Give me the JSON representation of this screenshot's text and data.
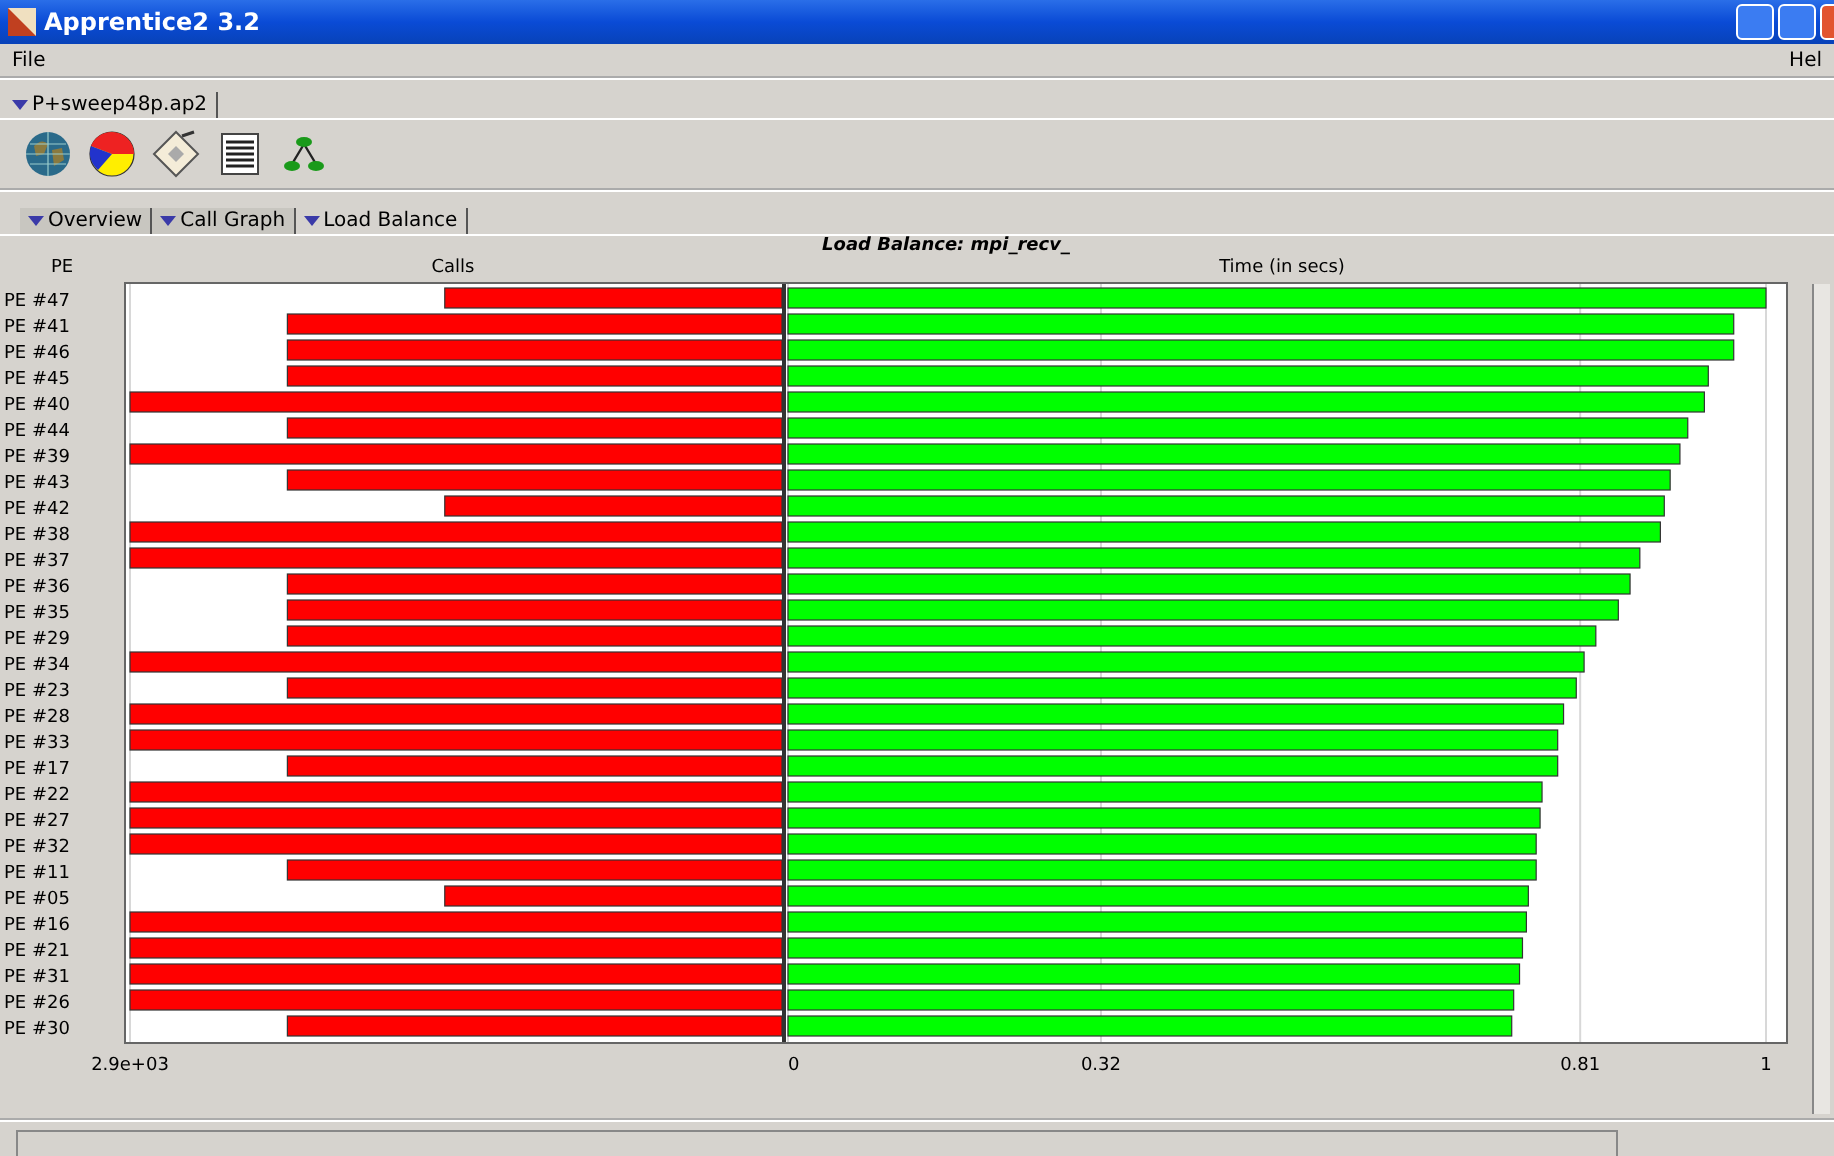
{
  "window": {
    "title": "Apprentice2 3.2"
  },
  "menu": [
    {
      "label": "File"
    },
    {
      "label": "Hel"
    }
  ],
  "file_tabs": [
    {
      "label": "P+sweep48p.ap2",
      "selected": true
    }
  ],
  "toolbar": [
    {
      "kind": "globe"
    },
    {
      "kind": "pie"
    },
    {
      "kind": "clipboard"
    },
    {
      "kind": "table"
    },
    {
      "kind": "tree"
    }
  ],
  "view_tabs": [
    {
      "label": "Overview",
      "selected": false
    },
    {
      "label": "Call Graph",
      "selected": false
    },
    {
      "label": "Load Balance",
      "selected": true
    }
  ],
  "panel": {
    "title": "Load Balance: mpi_recv_",
    "pe_header": "PE",
    "calls_chart": {
      "chart_data": {
        "type": "bar",
        "orientation": "horizontal",
        "title": "Calls",
        "xlim": [
          2900,
          0
        ],
        "xticks": [
          {
            "value": 2900,
            "label": "2.9e+03"
          }
        ],
        "categories": [
          "PE #47",
          "PE #41",
          "PE #46",
          "PE #45",
          "PE #40",
          "PE #44",
          "PE #39",
          "PE #43",
          "PE #42",
          "PE #38",
          "PE #37",
          "PE #36",
          "PE #35",
          "PE #29",
          "PE #34",
          "PE #23",
          "PE #28",
          "PE #33",
          "PE #17",
          "PE #22",
          "PE #27",
          "PE #32",
          "PE #11",
          "PE #05",
          "PE #16",
          "PE #21",
          "PE #31",
          "PE #26",
          "PE #30"
        ],
        "series": [
          {
            "color": "#ff0000",
            "values": [
              1500,
              2200,
              2200,
              2200,
              2900,
              2200,
              2900,
              2200,
              1500,
              2900,
              2900,
              2200,
              2200,
              2200,
              2900,
              2200,
              2900,
              2900,
              2200,
              2900,
              2900,
              2900,
              2200,
              1500,
              2900,
              2900,
              2900,
              2900,
              2200
            ]
          }
        ]
      }
    },
    "time_chart": {
      "chart_data": {
        "type": "bar",
        "orientation": "horizontal",
        "title": "Time (in secs)",
        "xlim": [
          0,
          1
        ],
        "xticks": [
          0,
          0.32,
          0.81,
          1
        ],
        "series": [
          {
            "color": "#00ff00",
            "values": [
              1.0,
              0.967,
              0.967,
              0.941,
              0.937,
              0.92,
              0.912,
              0.902,
              0.896,
              0.892,
              0.871,
              0.861,
              0.849,
              0.826,
              0.814,
              0.806,
              0.793,
              0.787,
              0.787,
              0.771,
              0.769,
              0.765,
              0.765,
              0.757,
              0.755,
              0.751,
              0.748,
              0.742,
              0.74
            ]
          }
        ]
      }
    }
  }
}
